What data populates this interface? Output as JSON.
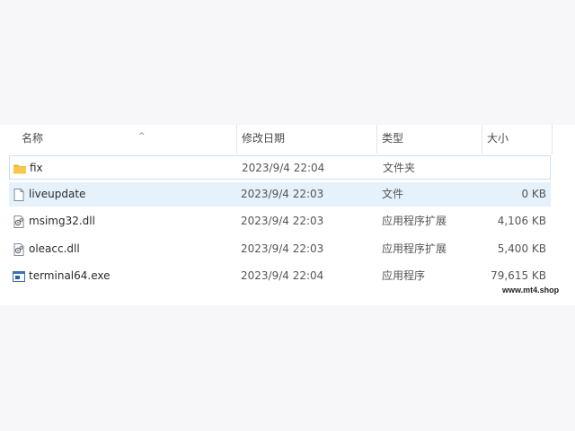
{
  "columns": {
    "name": "名称",
    "date": "修改日期",
    "type": "类型",
    "size": "大小"
  },
  "sort_indicator": "^",
  "files": [
    {
      "name": "fix",
      "date": "2023/9/4 22:04",
      "type": "文件夹",
      "size": "",
      "icon": "folder-icon"
    },
    {
      "name": "liveupdate",
      "date": "2023/9/4 22:03",
      "type": "文件",
      "size": "0 KB",
      "icon": "file-icon"
    },
    {
      "name": "msimg32.dll",
      "date": "2023/9/4 22:03",
      "type": "应用程序扩展",
      "size": "4,106 KB",
      "icon": "dll-file-icon"
    },
    {
      "name": "oleacc.dll",
      "date": "2023/9/4 22:03",
      "type": "应用程序扩展",
      "size": "5,400 KB",
      "icon": "dll-file-icon"
    },
    {
      "name": "terminal64.exe",
      "date": "2023/9/4 22:04",
      "type": "应用程序",
      "size": "79,615 KB",
      "icon": "exe-file-icon"
    }
  ],
  "watermark": "www.mt4.shop",
  "colors": {
    "selection": "#e5f1fb",
    "focus_border": "#c9dff2",
    "folder": "#f4c542"
  }
}
